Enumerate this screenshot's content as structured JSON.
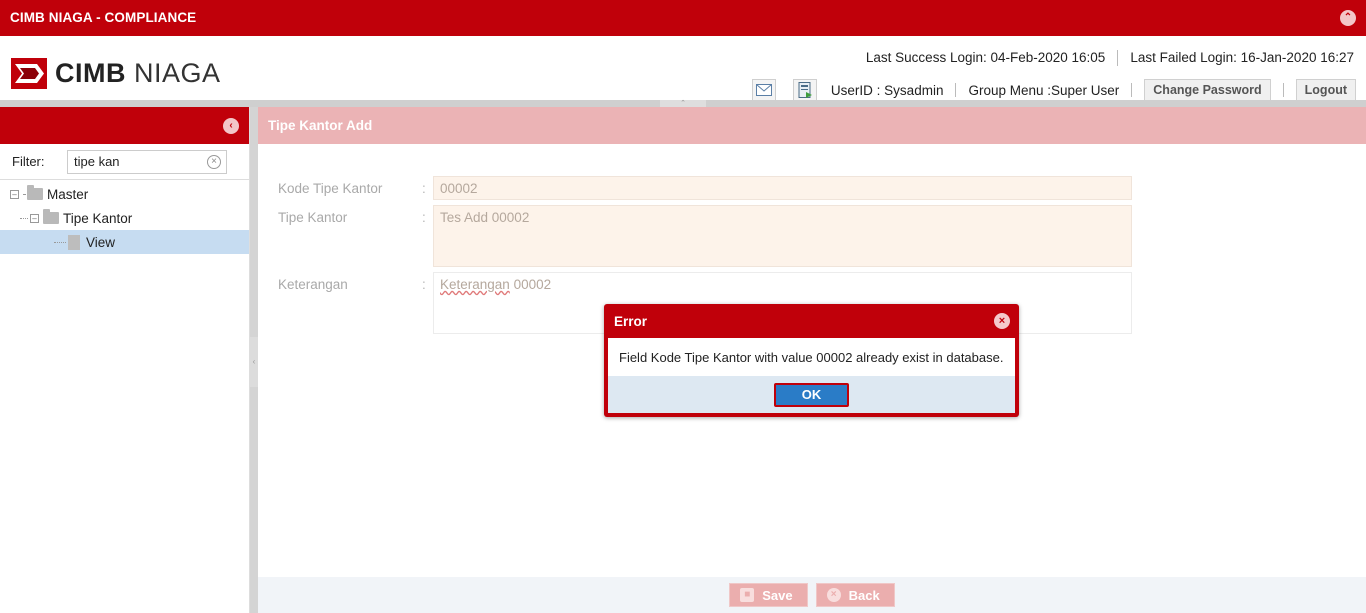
{
  "app": {
    "title": "CIMB NIAGA - COMPLIANCE"
  },
  "brand": {
    "logo_bold": "CIMB",
    "logo_light": "NIAGA",
    "accent": "#c0000a"
  },
  "header": {
    "last_success": "Last Success Login: 04-Feb-2020 16:05",
    "last_failed": "Last Failed Login: 16-Jan-2020 16:27",
    "user_id": "UserID : Sysadmin",
    "group_menu": "Group Menu :Super User",
    "change_password": "Change Password",
    "logout": "Logout"
  },
  "sidebar": {
    "filter_label": "Filter:",
    "filter_value": "tipe kan",
    "tree": [
      {
        "label": "Master"
      },
      {
        "label": "Tipe Kantor"
      },
      {
        "label": "View"
      }
    ]
  },
  "main": {
    "title": "Tipe Kantor Add",
    "fields": {
      "kode_label": "Kode Tipe Kantor",
      "kode_value": "00002",
      "tipe_label": "Tipe Kantor",
      "tipe_value": "Tes Add 00002",
      "ket_label": "Keterangan",
      "ket_value_word": "Keterangan",
      "ket_value_rest": " 00002",
      "colon": ":"
    },
    "footer": {
      "save": "Save",
      "back": "Back"
    }
  },
  "dialog": {
    "title": "Error",
    "message": "Field Kode Tipe Kantor with value 00002 already exist in database.",
    "ok": "OK"
  }
}
